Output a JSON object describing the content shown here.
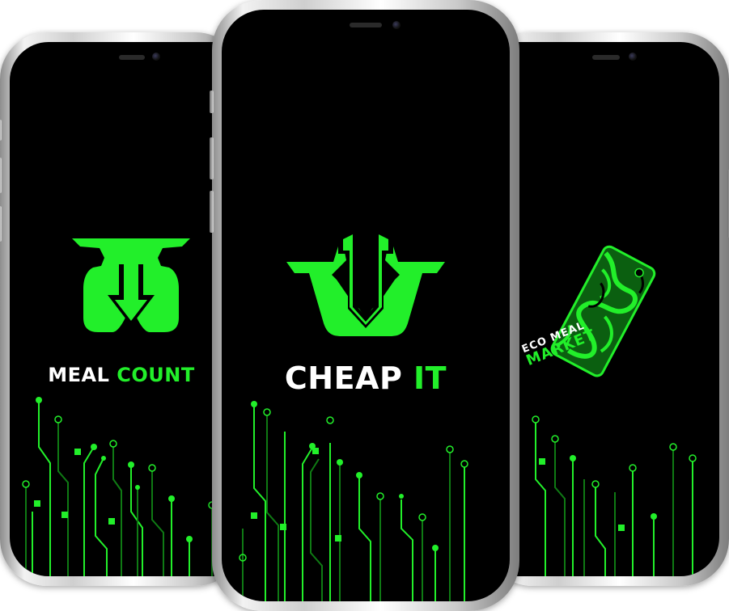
{
  "colors": {
    "accent_green": "#22ef2a",
    "dark_green": "#0f7a14",
    "text_white": "#ffffff",
    "screen_black": "#000000"
  },
  "phones": [
    {
      "id": "left",
      "app_name_part1": "MEAL",
      "app_name_part2": "COUNT",
      "logo_icon": "scale-arrow-icon"
    },
    {
      "id": "center",
      "app_name_part1": "CHEAP",
      "app_name_part2": "IT",
      "logo_icon": "basket-arrow-icon"
    },
    {
      "id": "right",
      "logo_icon": "price-tag-icon",
      "tag_line1_part1": "ECO",
      "tag_line1_part2": "MEAL",
      "tag_line2": "MARKET"
    }
  ]
}
